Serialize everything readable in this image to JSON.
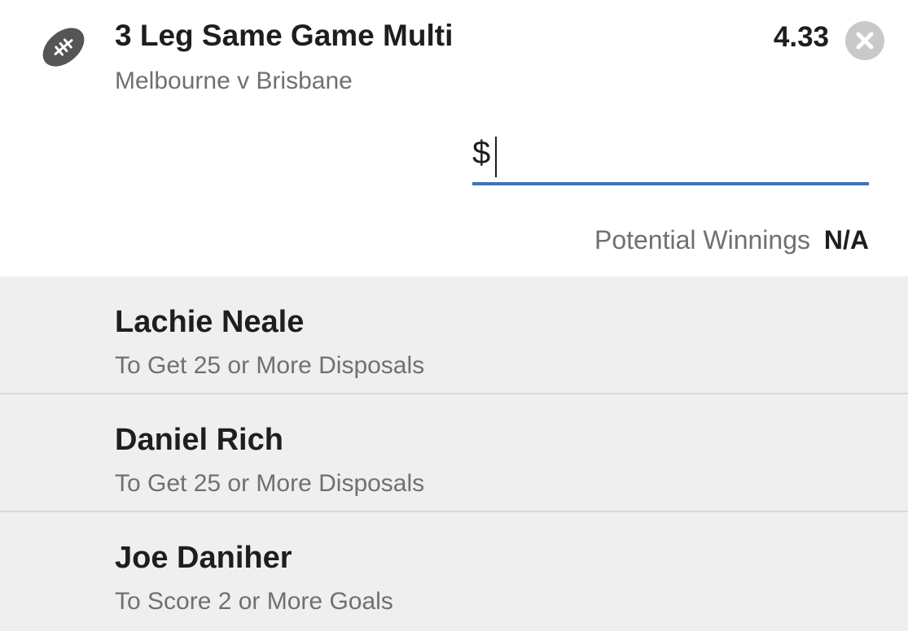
{
  "bet": {
    "title": "3 Leg Same Game Multi",
    "match": "Melbourne v Brisbane",
    "odds": "4.33",
    "sport_icon": "football-icon",
    "close_icon": "close-icon"
  },
  "stake": {
    "currency_symbol": "$",
    "value": "",
    "placeholder": ""
  },
  "winnings": {
    "label": "Potential Winnings",
    "value": "N/A"
  },
  "legs": [
    {
      "name": "Lachie Neale",
      "market": "To Get 25 or More Disposals"
    },
    {
      "name": "Daniel Rich",
      "market": "To Get 25 or More Disposals"
    },
    {
      "name": "Joe Daniher",
      "market": "To Score 2 or More Goals"
    }
  ],
  "colors": {
    "accent": "#3b73c4",
    "muted_text": "#707070",
    "legs_background": "#efefef",
    "close_button": "#c9c9c9"
  }
}
